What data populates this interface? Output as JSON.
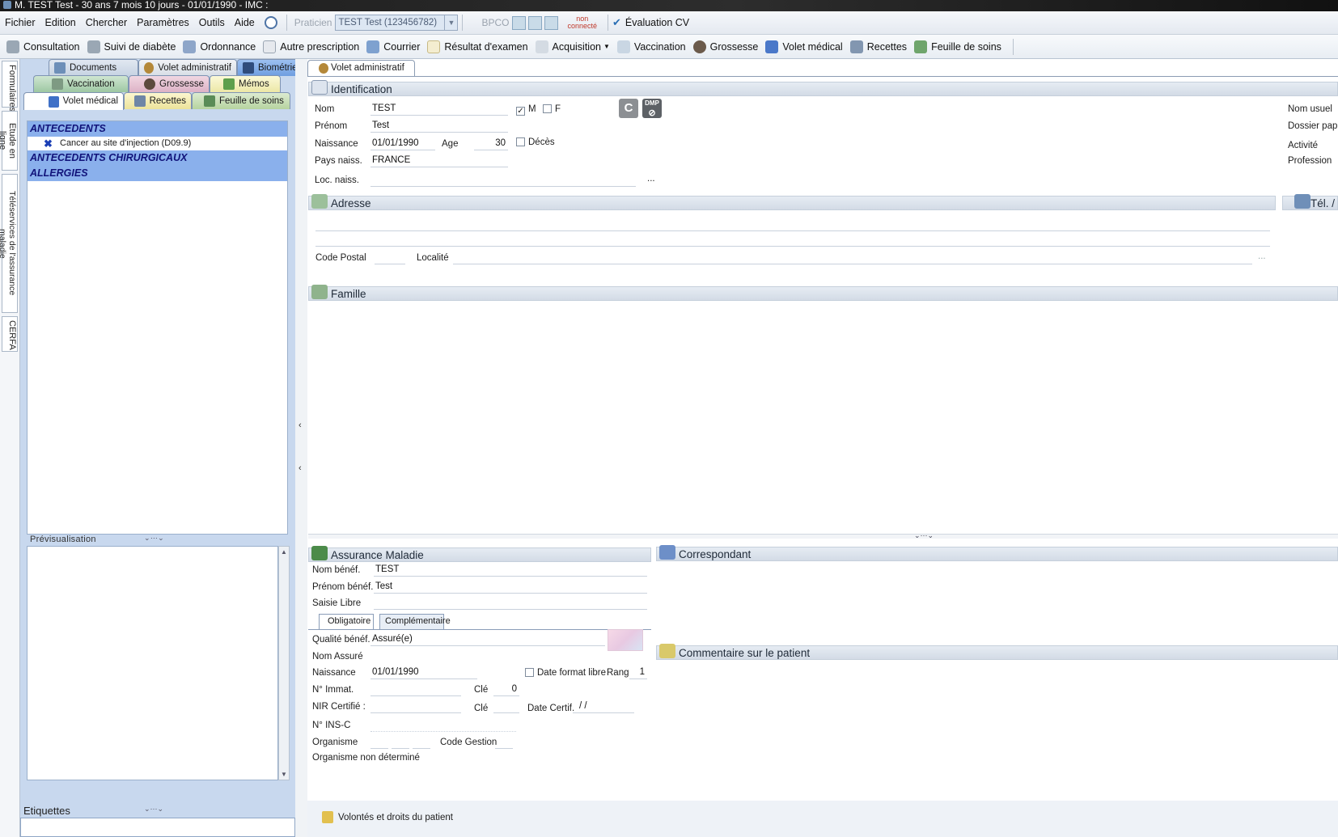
{
  "titlebar": {
    "text": "M. TEST Test - 30 ans 7 mois 10 jours - 01/01/1990 - IMC :"
  },
  "menu": {
    "items": [
      "Fichier",
      "Edition",
      "Chercher",
      "Paramètres",
      "Outils",
      "Aide"
    ],
    "praticien_label": "Praticien",
    "praticien_value": "TEST Test (123456782)",
    "bpco": "BPCO",
    "status_line1": "non",
    "status_line2": "connecté",
    "evaluation": "Évaluation CV"
  },
  "toolbar": {
    "items": [
      {
        "label": "Consultation",
        "icon": "stethoscope-icon"
      },
      {
        "label": "Suivi de diabète",
        "icon": "stethoscope-icon"
      },
      {
        "label": "Ordonnance",
        "icon": "pen-icon"
      },
      {
        "label": "Autre prescription",
        "icon": "document-icon"
      },
      {
        "label": "Courrier",
        "icon": "pen-icon"
      },
      {
        "label": "Résultat d'examen",
        "icon": "document-icon"
      },
      {
        "label": "Acquisition",
        "icon": "scanner-icon"
      },
      {
        "label": "Vaccination",
        "icon": "syringe-icon"
      },
      {
        "label": "Grossesse",
        "icon": "pregnancy-icon"
      },
      {
        "label": "Volet médical",
        "icon": "medical-cross-icon"
      },
      {
        "label": "Recettes",
        "icon": "calculator-icon"
      },
      {
        "label": "Feuille de soins",
        "icon": "care-sheet-icon"
      }
    ]
  },
  "side_tabs": [
    "Formulaires",
    "Etude en ligne",
    "Téléservices de l'assurance maladie",
    "CERFA"
  ],
  "left": {
    "tabs_row1": [
      "Documents",
      "Volet administratif",
      "Biométrie"
    ],
    "tabs_row2": [
      "Vaccination",
      "Grossesse",
      "Mémos"
    ],
    "tabs_row3": [
      "Volet médical",
      "Recettes",
      "Feuille de soins"
    ],
    "sections": [
      {
        "title": "ANTECEDENTS",
        "items": [
          "Cancer au site d'injection (D09.9)"
        ]
      },
      {
        "title": "ANTECEDENTS CHIRURGICAUX",
        "items": []
      },
      {
        "title": "ALLERGIES",
        "items": []
      }
    ],
    "preview_label": "Prévisualisation",
    "etiquettes_label": "Etiquettes"
  },
  "main": {
    "tab_label": "Volet administratif",
    "identification": {
      "title": "Identification",
      "nom_label": "Nom",
      "nom": "TEST",
      "prenom_label": "Prénom",
      "prenom": "Test",
      "naissance_label": "Naissance",
      "naissance": "01/01/1990",
      "age_label": "Age",
      "age": "30",
      "deces_label": "Décès",
      "pays_label": "Pays naiss.",
      "pays": "FRANCE",
      "loc_label": "Loc. naiss.",
      "loc_dots": "...",
      "sex_m": "M",
      "sex_f": "F",
      "sex_m_checked": true,
      "c_button": "C",
      "dmp_button": "DMP",
      "nom_usuel_label": "Nom usuel",
      "dossier_label": "Dossier papier",
      "activite_label": "Activité",
      "profession_label": "Profession"
    },
    "adresse": {
      "title": "Adresse",
      "cp_label": "Code Postal",
      "localite_label": "Localité",
      "dots": "..."
    },
    "tel": {
      "title": "Tél. /"
    },
    "famille": {
      "title": "Famille"
    },
    "assurance": {
      "title": "Assurance Maladie",
      "nom_benef_label": "Nom bénéf.",
      "nom_benef": "TEST",
      "prenom_benef_label": "Prénom bénéf.",
      "prenom_benef": "Test",
      "saisie_label": "Saisie Libre",
      "subtabs": [
        "Obligatoire",
        "Complémentaire"
      ],
      "qualite_label": "Qualité bénéf.",
      "qualite": "Assuré(e)",
      "nom_assure_label": "Nom Assuré",
      "naissance_label": "Naissance",
      "naissance": "01/01/1990",
      "date_format_label": "Date format libre",
      "rang_label": "Rang",
      "rang": "1",
      "immat_label": "N° Immat.",
      "cle_label": "Clé",
      "cle": "0",
      "nir_label": "NIR Certifié :",
      "cle2_label": "Clé",
      "date_certif_label": "Date Certif.",
      "date_certif": "/ /",
      "insc_label": "N° INS-C",
      "organisme_label": "Organisme",
      "code_gestion_label": "Code Gestion",
      "organisme_status": "Organisme non déterminé"
    },
    "correspondant": {
      "title": "Correspondant"
    },
    "commentaire": {
      "title": "Commentaire sur le patient"
    },
    "volontes": "Volontés et droits du patient"
  },
  "colors": {
    "accent": "#8ab0ec",
    "header_text": "#11137a",
    "panel_bg": "#c8d8ee"
  }
}
